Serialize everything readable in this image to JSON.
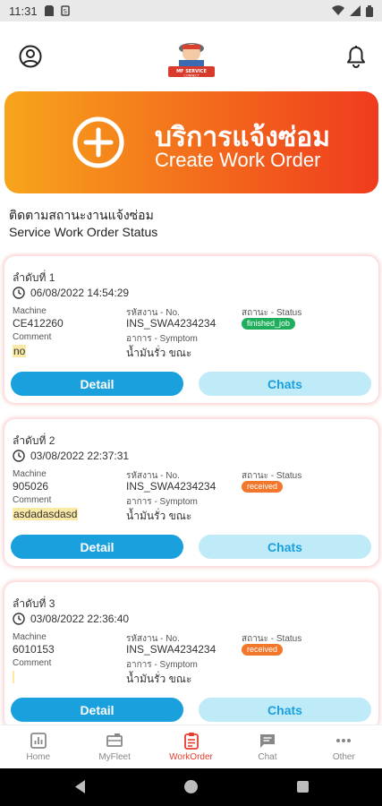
{
  "status_bar": {
    "time": "11:31"
  },
  "header": {
    "logo_text": "MF SERVICE CONNECT"
  },
  "banner": {
    "title_th": "บริการแจ้งซ่อม",
    "title_en": "Create Work Order"
  },
  "section": {
    "title_th": "ติดตามสถานะงานแจ้งซ่อม",
    "title_en": "Service Work Order Status"
  },
  "labels": {
    "machine": "Machine",
    "comment": "Comment",
    "no": "รหัสงาน - No.",
    "symptom": "อาการ - Symptom",
    "status": "สถานะ - Status",
    "detail": "Detail",
    "chats": "Chats"
  },
  "cards": [
    {
      "seq": "ลำดับที่ 1",
      "datetime": "06/08/2022 14:54:29",
      "machine": "CE412260",
      "comment": "no",
      "no": "INS_SWA4234234",
      "symptom": "น้ำมันรั่ว ขณะ",
      "status": "finished_job",
      "status_color": "#1fae5c"
    },
    {
      "seq": "ลำดับที่ 2",
      "datetime": "03/08/2022 22:37:31",
      "machine": "905026",
      "comment": "asdadasdasd",
      "no": "INS_SWA4234234",
      "symptom": "น้ำมันรั่ว ขณะ",
      "status": "received",
      "status_color": "#f2772b"
    },
    {
      "seq": "ลำดับที่ 3",
      "datetime": "03/08/2022 22:36:40",
      "machine": "6010153",
      "comment": "",
      "no": "INS_SWA4234234",
      "symptom": "น้ำมันรั่ว ขณะ",
      "status": "received",
      "status_color": "#f2772b"
    }
  ],
  "bottom_nav": [
    {
      "label": "Home",
      "icon": "home-chart-icon"
    },
    {
      "label": "MyFleet",
      "icon": "truck-icon"
    },
    {
      "label": "WorkOrder",
      "icon": "clipboard-icon",
      "active": true
    },
    {
      "label": "Chat",
      "icon": "chat-icon"
    },
    {
      "label": "Other",
      "icon": "more-icon"
    }
  ],
  "colors": {
    "accent": "#e43d2f",
    "primary_button": "#1aa0dd",
    "secondary_button": "#bfeaf8"
  }
}
